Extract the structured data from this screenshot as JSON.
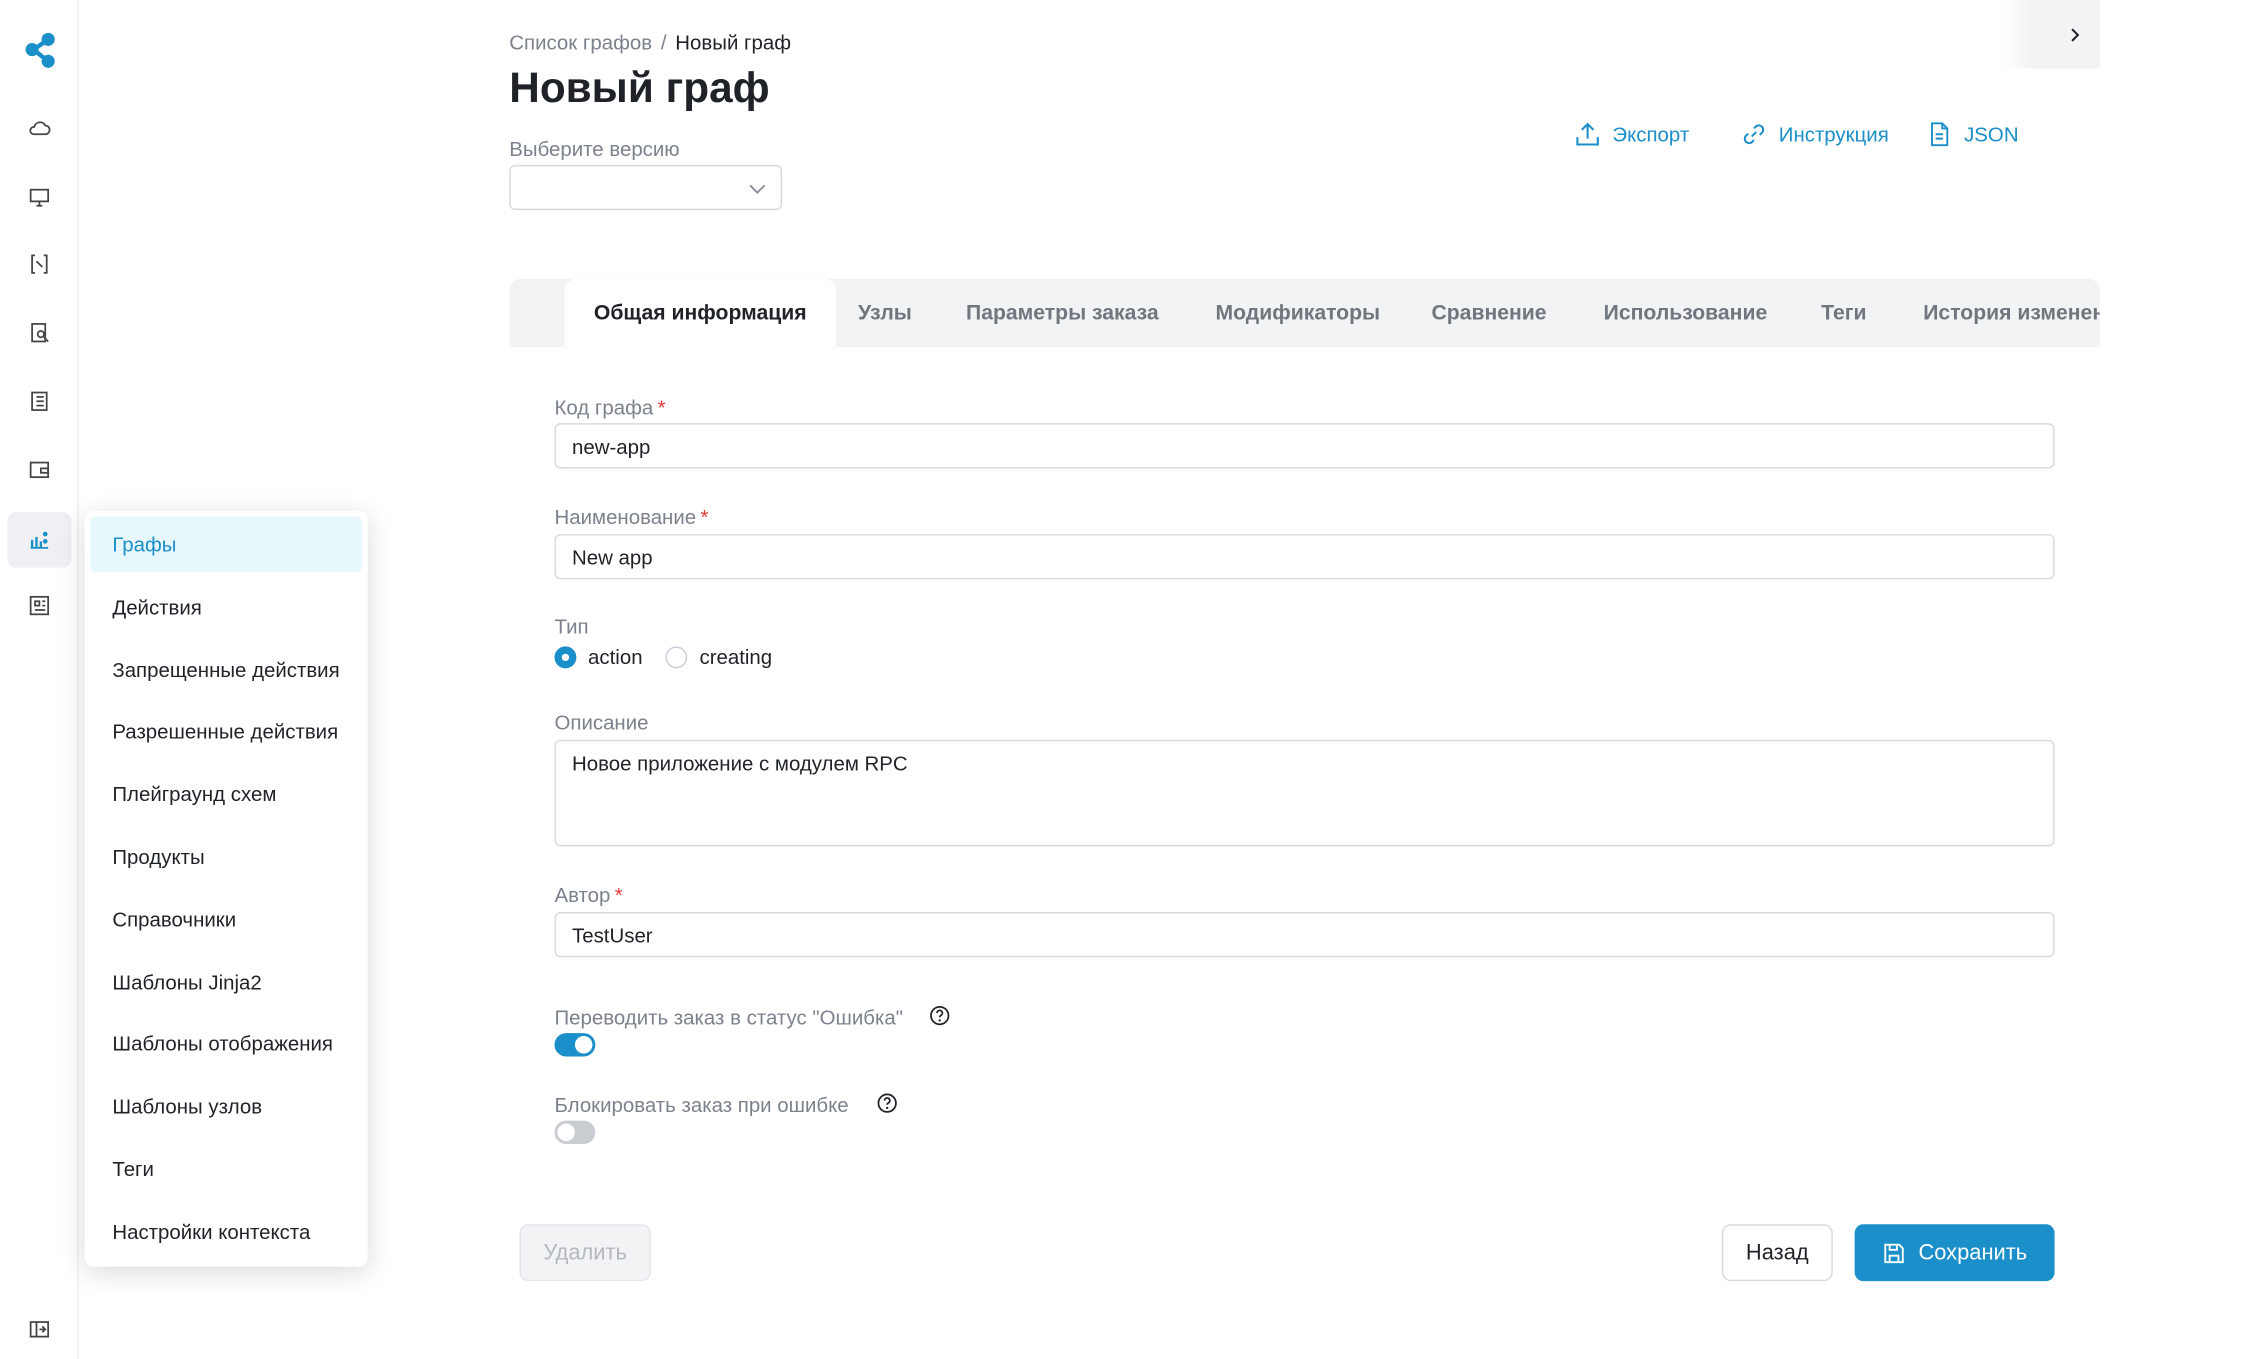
{
  "breadcrumb": {
    "parent": "Список графов",
    "separator": "/",
    "current": "Новый граф"
  },
  "page_title": "Новый граф",
  "version": {
    "label": "Выберите версию",
    "value": ""
  },
  "header_actions": [
    {
      "label": "Экспорт",
      "icon": "upload-icon"
    },
    {
      "label": "Инструкция",
      "icon": "link-icon"
    },
    {
      "label": "JSON",
      "icon": "document-icon"
    }
  ],
  "tabs": [
    "Общая информация",
    "Узлы",
    "Параметры заказа",
    "Модификаторы",
    "Сравнение",
    "Использование",
    "Теги",
    "История изменений"
  ],
  "active_tab": "Общая информация",
  "form": {
    "code_label": "Код графа",
    "code_value": "new-app",
    "name_label": "Наименование",
    "name_value": "New app",
    "type_label": "Тип",
    "type_options": [
      "action",
      "creating"
    ],
    "type_selected": "action",
    "description_label": "Описание",
    "description_value": "Новое приложение с модулем RPC",
    "author_label": "Автор",
    "author_value": "TestUser",
    "required_mark": "*",
    "error_status_label": "Переводить заказ в статус \"Ошибка\"",
    "error_status_on": true,
    "block_on_error_label": "Блокировать заказ при ошибке",
    "block_on_error_on": false
  },
  "buttons": {
    "delete": "Удалить",
    "back": "Назад",
    "save": "Сохранить"
  },
  "sidebar_menu": [
    "Графы",
    "Действия",
    "Запрещенные действия",
    "Разрешенные действия",
    "Плейграунд схем",
    "Продукты",
    "Справочники",
    "Шаблоны Jinja2",
    "Шаблоны отображения",
    "Шаблоны узлов",
    "Теги",
    "Настройки контекста"
  ],
  "sidebar_active": "Графы",
  "colors": {
    "accent": "#1a8fc9",
    "required": "#e53935",
    "muted_text": "#7b828c"
  }
}
